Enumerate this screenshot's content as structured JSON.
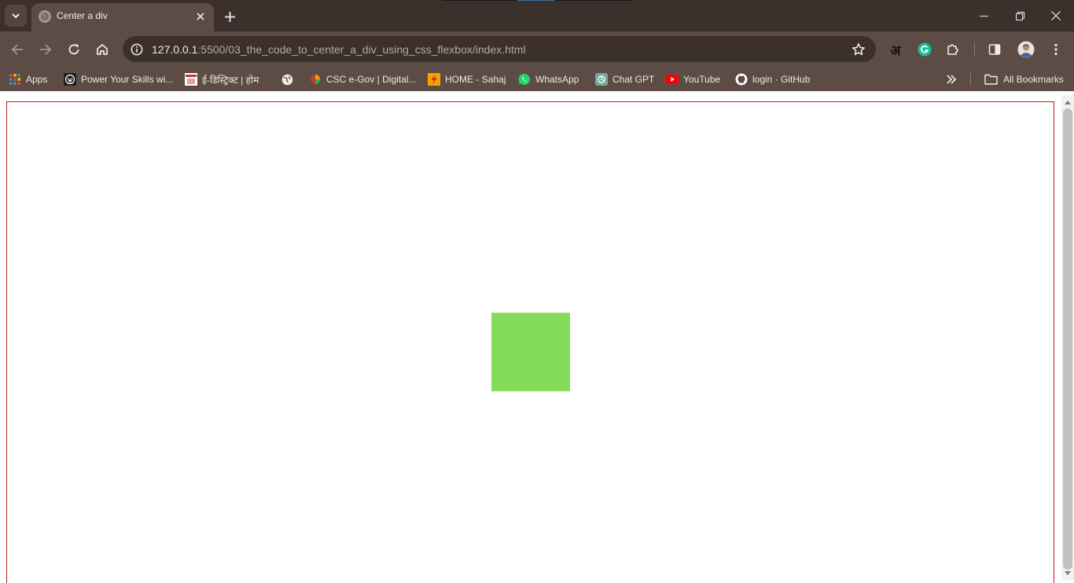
{
  "tab": {
    "title": "Center a div"
  },
  "address": {
    "host": "127.0.0.1",
    "path": ":5500/03_the_code_to_center_a_div_using_css_flexbox/index.html"
  },
  "toolbar": {
    "translate_label": "अ"
  },
  "bookmarks": {
    "items": [
      {
        "label": "Apps",
        "icon": "apps-grid-icon"
      },
      {
        "label": "Power Your Skills wi...",
        "icon": "wordpress-icon"
      },
      {
        "label": "ई-डिस्ट्रिक्ट | होम",
        "icon": "edistrict-icon"
      },
      {
        "label": "",
        "icon": "globe-icon"
      },
      {
        "label": "CSC e-Gov | Digital...",
        "icon": "csc-icon"
      },
      {
        "label": "HOME - Sahaj",
        "icon": "sahaj-icon"
      },
      {
        "label": "WhatsApp",
        "icon": "whatsapp-icon"
      },
      {
        "label": "Chat GPT",
        "icon": "chatgpt-icon"
      },
      {
        "label": "YouTube",
        "icon": "youtube-icon"
      },
      {
        "label": "login · GitHub",
        "icon": "github-icon"
      }
    ],
    "all_bookmarks_label": "All Bookmarks"
  },
  "colors": {
    "frame": "#3b302c",
    "toolbar": "#5c4c45",
    "container_border": "#b91c1c",
    "box": "#83dc5a"
  }
}
